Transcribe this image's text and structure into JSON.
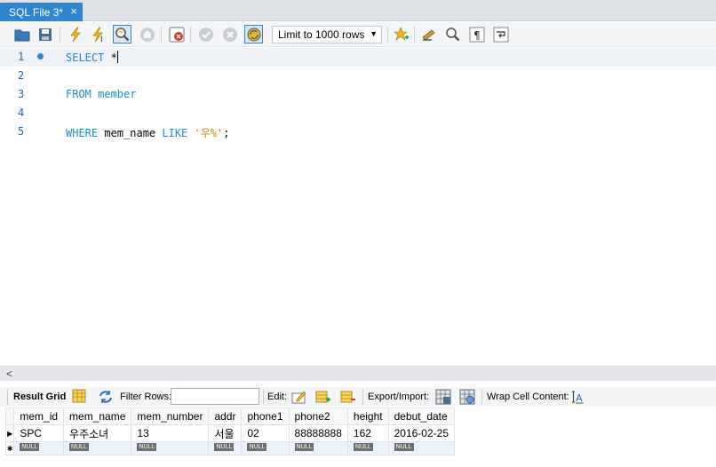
{
  "tab": {
    "title": "SQL File 3*",
    "close": "×"
  },
  "toolbar": {
    "limit_label": "Limit to 1000 rows",
    "icons": [
      "open-folder-icon",
      "save-icon",
      "execute-icon",
      "execute-current-icon",
      "explain-icon",
      "stop-icon",
      "toggle-error-icon",
      "commit-icon",
      "rollback-icon",
      "autocommit-icon",
      "bookmark-icon",
      "beautify-icon",
      "find-icon",
      "invisible-chars-icon",
      "wrap-icon"
    ]
  },
  "editor": {
    "lines": [
      {
        "num": "1",
        "current": true
      },
      {
        "num": "2"
      },
      {
        "num": "3"
      },
      {
        "num": "4"
      },
      {
        "num": "5"
      }
    ],
    "line1": {
      "kw": "SELECT",
      "rest": " *"
    },
    "line3": {
      "kw1": "FROM",
      "rest": " member"
    },
    "line5": {
      "kw1": "WHERE",
      "mid": " mem_name ",
      "kw2": "LIKE",
      "sp": " ",
      "str": "'우%'",
      "end": ";"
    }
  },
  "hscroll": {
    "left_arrow": "<"
  },
  "result_bar": {
    "result_grid": "Result Grid",
    "filter_rows": "Filter Rows:",
    "edit": "Edit:",
    "export_import": "Export/Import:",
    "wrap_cell": "Wrap Cell Content:"
  },
  "grid": {
    "columns": [
      "mem_id",
      "mem_name",
      "mem_number",
      "addr",
      "phone1",
      "phone2",
      "height",
      "debut_date"
    ],
    "rows": [
      [
        "SPC",
        "우주소녀",
        "13",
        "서울",
        "02",
        "88888888",
        "162",
        "2016-02-25"
      ]
    ],
    "null_label": "NULL",
    "row_marker": "▶",
    "new_row_marker": "✱"
  },
  "colors": {
    "tab_active": "#2e85d0",
    "keyword": "#1c8cc4",
    "string": "#d37c16",
    "line_number": "#2f5e9e"
  }
}
